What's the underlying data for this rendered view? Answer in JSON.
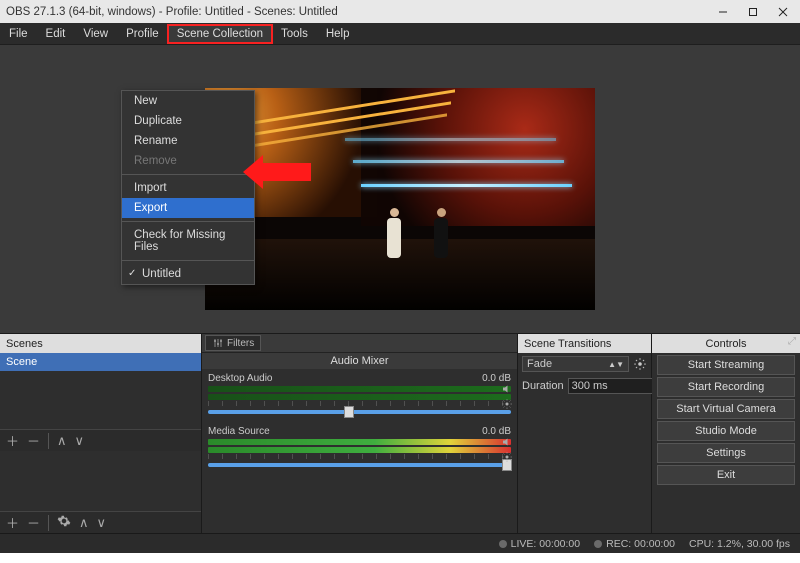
{
  "title": "OBS 27.1.3 (64-bit, windows) - Profile: Untitled - Scenes: Untitled",
  "menubar": [
    "File",
    "Edit",
    "View",
    "Profile",
    "Scene Collection",
    "Tools",
    "Help"
  ],
  "dropdown": {
    "items": [
      "New",
      "Duplicate",
      "Rename",
      "Remove",
      "Import",
      "Export",
      "Check for Missing Files",
      "Untitled"
    ],
    "disabled_index": 3,
    "selected_index": 5,
    "checked_index": 7
  },
  "scenes": {
    "title": "Scenes",
    "items": [
      "Scene"
    ]
  },
  "mixer": {
    "filters_label": "Filters",
    "title": "Audio Mixer",
    "tracks": [
      {
        "name": "Desktop Audio",
        "db": "0.0 dB"
      },
      {
        "name": "Media Source",
        "db": "0.0 dB"
      }
    ]
  },
  "transitions": {
    "title": "Scene Transitions",
    "mode": "Fade",
    "duration_label": "Duration",
    "duration_value": "300 ms"
  },
  "controls": {
    "title": "Controls",
    "buttons": [
      "Start Streaming",
      "Start Recording",
      "Start Virtual Camera",
      "Studio Mode",
      "Settings",
      "Exit"
    ]
  },
  "status": {
    "live": "LIVE: 00:00:00",
    "rec": "REC: 00:00:00",
    "cpu": "CPU: 1.2%, 30.00 fps"
  }
}
